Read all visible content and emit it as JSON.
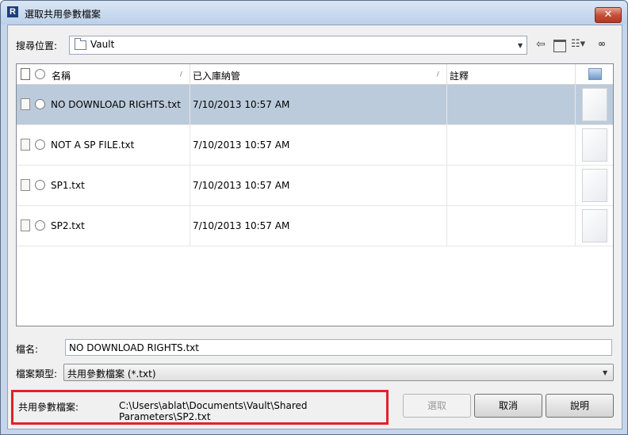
{
  "window": {
    "title": "選取共用參數檔案",
    "app_icon": "R",
    "close_glyph": "✕"
  },
  "lookin": {
    "label": "搜尋位置:",
    "value": "Vault"
  },
  "columns": {
    "name": "名稱",
    "date": "已入庫納管",
    "comment": "註釋"
  },
  "files": [
    {
      "name": "NO DOWNLOAD RIGHTS.txt",
      "date": "7/10/2013 10:57 AM"
    },
    {
      "name": "NOT A SP FILE.txt",
      "date": "7/10/2013 10:57 AM"
    },
    {
      "name": "SP1.txt",
      "date": "7/10/2013 10:57 AM"
    },
    {
      "name": "SP2.txt",
      "date": "7/10/2013 10:57 AM"
    }
  ],
  "filename": {
    "label": "檔名:",
    "value": "NO DOWNLOAD RIGHTS.txt"
  },
  "filetype": {
    "label": "檔案類型:",
    "value": "共用參數檔案 (*.txt)"
  },
  "shared": {
    "label": "共用參數檔案:",
    "path": "C:\\Users\\ablat\\Documents\\Vault\\Shared Parameters\\SP2.txt"
  },
  "buttons": {
    "select": "選取",
    "cancel": "取消",
    "help": "說明"
  },
  "colors": {
    "selected_row": "#bccbdb",
    "highlight_box": "#e22228",
    "close_button": "#c7503b"
  },
  "icons": {
    "back": "back-arrow-icon",
    "up_folder": "up-folder-icon",
    "views": "views-icon",
    "find": "binoculars-icon"
  }
}
